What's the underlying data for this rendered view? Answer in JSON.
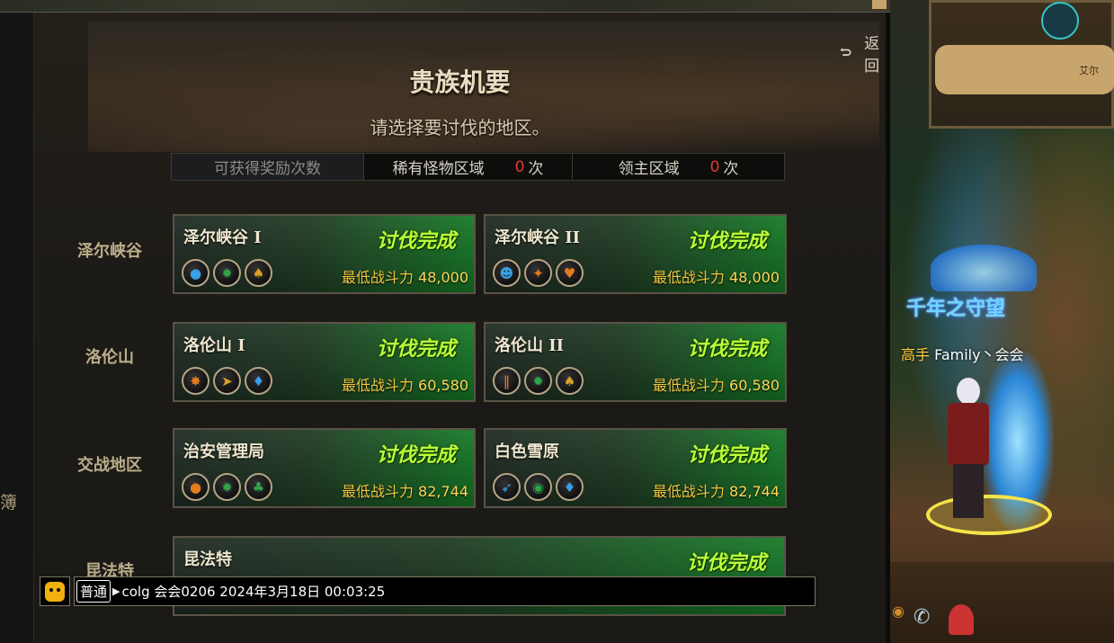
{
  "panel": {
    "title": "贵族机要",
    "subtitle": "请选择要讨伐的地区。",
    "back_label": "返回",
    "left_edge_char": "簿"
  },
  "reward_bar": {
    "label": "可获得奖励次数",
    "rare_label": "稀有怪物区域",
    "rare_count": "0",
    "lord_label": "领主区域",
    "lord_count": "0",
    "unit": "次"
  },
  "regions": [
    {
      "label": "泽尔峡谷",
      "dungeons": [
        {
          "name": "泽尔峡谷 I",
          "status": "讨伐完成",
          "power_label": "最低战斗力",
          "power": "48,000",
          "badges": [
            "blue-person-icon",
            "green-star-icon",
            "gold-spade-icon"
          ]
        },
        {
          "name": "泽尔峡谷 II",
          "status": "讨伐完成",
          "power_label": "最低战斗力",
          "power": "48,000",
          "badges": [
            "blue-face-icon",
            "orange-feather-icon",
            "orange-heart-icon"
          ]
        }
      ]
    },
    {
      "label": "洛伦山",
      "dungeons": [
        {
          "name": "洛伦山 I",
          "status": "讨伐完成",
          "power_label": "最低战斗力",
          "power": "60,580",
          "badges": [
            "orange-star-icon",
            "gold-boot-icon",
            "blue-diamond-icon"
          ]
        },
        {
          "name": "洛伦山 II",
          "status": "讨伐完成",
          "power_label": "最低战斗力",
          "power": "60,580",
          "badges": [
            "orange-claw-icon",
            "green-star-icon",
            "gold-spade-icon"
          ]
        }
      ]
    },
    {
      "label": "交战地区",
      "dungeons": [
        {
          "name": "治安管理局",
          "status": "讨伐完成",
          "power_label": "最低战斗力",
          "power": "82,744",
          "badges": [
            "orange-person-icon",
            "green-star-icon",
            "green-club-icon"
          ]
        },
        {
          "name": "白色雪原",
          "status": "讨伐完成",
          "power_label": "最低战斗力",
          "power": "82,744",
          "badges": [
            "blue-wolf-icon",
            "green-eye-icon",
            "blue-diamond-icon"
          ]
        }
      ]
    },
    {
      "label": "昆法特",
      "dungeons": [
        {
          "name": "昆法特",
          "status": "讨伐完成"
        }
      ]
    }
  ],
  "chat": {
    "channel": "普通",
    "message": "colg 会会0206 2024年3月18日 00:03:25"
  },
  "scene": {
    "guild_title": "千年之守望",
    "player_prefix": "高手",
    "player_name": "Family丶会会",
    "minimap_label": "艾尔"
  },
  "colors": {
    "status_green": "#b8ff3a",
    "power_gold": "#f0c640",
    "reward_red": "#e03a2c"
  }
}
